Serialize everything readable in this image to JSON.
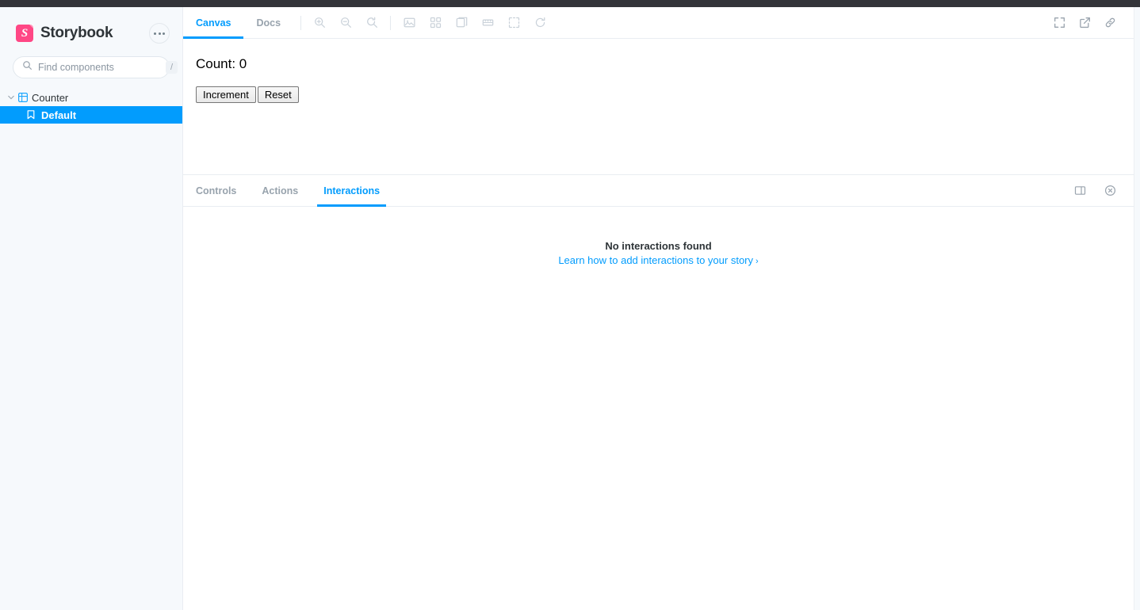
{
  "topbar": {
    "color": "#333439"
  },
  "sidebar": {
    "brand": {
      "name": "Storybook",
      "mark_letter": "S",
      "mark_color": "#FF4785"
    },
    "menu_button": {
      "name": "more-options"
    },
    "search": {
      "placeholder": "Find components",
      "value": "",
      "shortcut": "/"
    },
    "tree": [
      {
        "type": "component",
        "label": "Counter",
        "expanded": true,
        "icon": "component-grid-icon"
      },
      {
        "type": "story",
        "label": "Default",
        "selected": true,
        "icon": "bookmark-icon"
      }
    ]
  },
  "preview": {
    "tabs": [
      {
        "label": "Canvas",
        "active": true
      },
      {
        "label": "Docs",
        "active": false
      }
    ],
    "zoom_tools": [
      {
        "name": "zoom-in-icon",
        "title": "Zoom in"
      },
      {
        "name": "zoom-out-icon",
        "title": "Zoom out"
      },
      {
        "name": "zoom-reset-icon",
        "title": "Reset zoom"
      }
    ],
    "addon_tools": [
      {
        "name": "backgrounds-icon",
        "title": "Change background"
      },
      {
        "name": "grid-icon",
        "title": "Apply grid"
      },
      {
        "name": "viewport-icon",
        "title": "Change viewport"
      },
      {
        "name": "measure-icon",
        "title": "Measure"
      },
      {
        "name": "outline-icon",
        "title": "Outline"
      },
      {
        "name": "remount-icon",
        "title": "Remount component"
      }
    ],
    "right_tools": [
      {
        "name": "fullscreen-icon",
        "title": "Go full screen"
      },
      {
        "name": "open-new-tab-icon",
        "title": "Open canvas in new tab"
      },
      {
        "name": "copy-link-icon",
        "title": "Copy canvas link"
      }
    ]
  },
  "story": {
    "count_label": "Count: 0",
    "buttons": [
      {
        "label": "Increment"
      },
      {
        "label": "Reset"
      }
    ]
  },
  "addon_panel": {
    "tabs": [
      {
        "label": "Controls",
        "active": false
      },
      {
        "label": "Actions",
        "active": false
      },
      {
        "label": "Interactions",
        "active": true
      }
    ],
    "right_tools": [
      {
        "name": "panel-position-icon",
        "title": "Change addon orientation"
      },
      {
        "name": "close-panel-icon",
        "title": "Hide addons"
      }
    ],
    "empty_state": {
      "title": "No interactions found",
      "link": "Learn how to add interactions to your story",
      "link_caret": "›"
    }
  },
  "theme": {
    "accent": "#029CFD",
    "brand_pink": "#FF4785",
    "sidebar_bg": "#F6F9FC",
    "border": "#E9EDF2",
    "muted_text": "#98A3AD"
  }
}
